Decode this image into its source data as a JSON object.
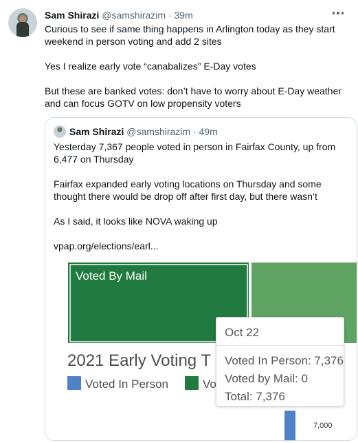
{
  "tweet": {
    "author_name": "Sam Shirazi",
    "handle": "@samshirazim",
    "separator": "·",
    "time": "39m",
    "paragraphs": [
      "Curious to see if same thing happens in Arlington today as they start weekend in person voting and add 2 sites",
      "Yes I realize early vote “canabalizes” E-Day votes",
      "But these are banked votes: don’t have to worry about E-Day weather and can focus GOTV on low propensity voters"
    ]
  },
  "quoted_tweet": {
    "author_name": "Sam Shirazi",
    "handle": "@samshirazim",
    "separator": "·",
    "time": "49m",
    "paragraphs": [
      "Yesterday 7,367 people voted in person in Fairfax County, up from 6,477 on Thursday",
      "Fairfax expanded early voting locations on Thursday and some thought there would be drop off after first day, but there wasn’t",
      "As I said, it looks like NOVA waking up",
      "vpap.org/elections/earl..."
    ]
  },
  "media_chart": {
    "block_label": "Voted By Mail",
    "title": "2021 Early Voting T",
    "legend": [
      "Voted In Person",
      "Vo"
    ],
    "axis_value": "7,000",
    "tooltip": {
      "title": "Oct 22",
      "lines": [
        "Voted In Person: 7,376",
        "Voted by Mail: 0",
        "Total: 7,376"
      ]
    },
    "colors": {
      "mail_dark": "#217a3f",
      "mail_light": "#5fa463",
      "in_person": "#5082c8"
    }
  }
}
